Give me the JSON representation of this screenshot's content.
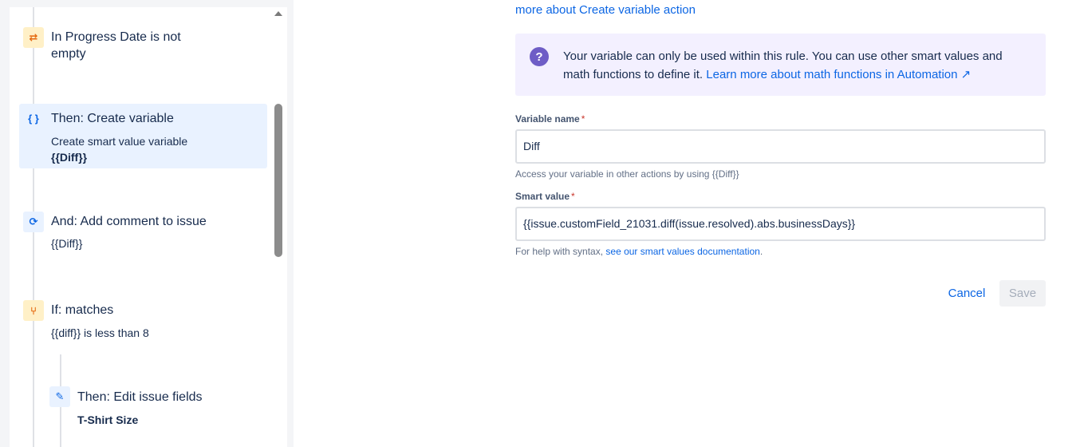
{
  "rule_steps": [
    {
      "title": "In Progress Date is not empty",
      "title_line1": "In Progress Date is not",
      "title_line2": "empty",
      "icon": "shuffle-icon"
    },
    {
      "title": "Then: Create variable",
      "sub1": "Create smart value variable",
      "sub2": "{{Diff}}",
      "icon": "braces-icon",
      "selected": true
    },
    {
      "title": "And: Add comment to issue",
      "sub1": "{{Diff}}",
      "icon": "refresh-icon"
    },
    {
      "title": "If: matches",
      "sub1": "{{diff}} is less than 8",
      "icon": "branch-icon"
    },
    {
      "title": "Then: Edit issue fields",
      "sub1": "T-Shirt Size",
      "icon": "pencil-icon"
    }
  ],
  "config": {
    "top_link": "more about Create variable action",
    "info_text": "Your variable can only be used within this rule. You can use other smart values and math functions to define it.",
    "info_link": "Learn more about math functions in Automation ↗",
    "variable_name_label": "Variable name",
    "required_mark": "*",
    "variable_name_value": "Diff",
    "variable_name_helper": "Access your variable in other actions by using {{Diff}}",
    "smart_value_label": "Smart value",
    "smart_value_value": "{{issue.customField_21031.diff(issue.resolved).abs.businessDays}}",
    "smart_value_helper": "For help with syntax,",
    "smart_value_link": "see our smart values documentation",
    "smart_value_helper_end": ".",
    "cancel_label": "Cancel",
    "save_label": "Save"
  },
  "colors": {
    "accent": "#0c66e4",
    "selected_bg": "#e9f2ff",
    "info_bg": "#f3f0ff",
    "condition_icon": "#e56910"
  }
}
